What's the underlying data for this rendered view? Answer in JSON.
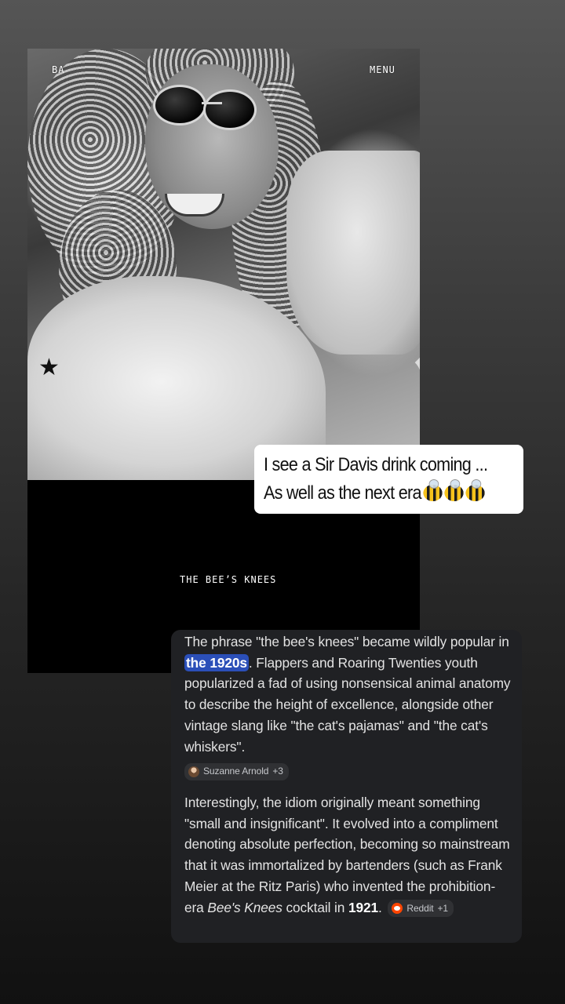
{
  "post": {
    "top_left_label": "BA",
    "top_right_label": "MENU",
    "caption": "THE BEE’S KNEES"
  },
  "sticker": {
    "line1": "I see a Sir Davis drink coming ...",
    "line2": "As well as the next era",
    "emoji": "bee-icon x3"
  },
  "ai_card": {
    "para1_part1": "The phrase \"the bee's knees\" became wildly popular in ",
    "para1_highlight": "the 1920s",
    "para1_part2": ". Flappers and Roaring Twenties youth popularized a fad of using nonsensical animal anatomy to describe the height of excellence, alongside other vintage slang like \"the cat's pajamas\" and \"the cat's whiskers\".",
    "source1_name": "Suzanne Arnold",
    "source1_count": "+3",
    "para2_part1": "Interestingly, the idiom originally meant something \"small and insignificant\". It evolved into a compliment denoting absolute perfection, becoming so mainstream that it was immortalized by bartenders (such as Frank Meier at the Ritz Paris) who invented the prohibition-era ",
    "para2_italic": "Bee's Knees",
    "para2_part2": " cocktail in ",
    "para2_bold": "1921",
    "para2_end": ".",
    "source2_name": "Reddit",
    "source2_count": "+1"
  },
  "colors": {
    "card_bg": "#202124",
    "highlight": "#2b4fb8",
    "reddit": "#ff4500"
  }
}
